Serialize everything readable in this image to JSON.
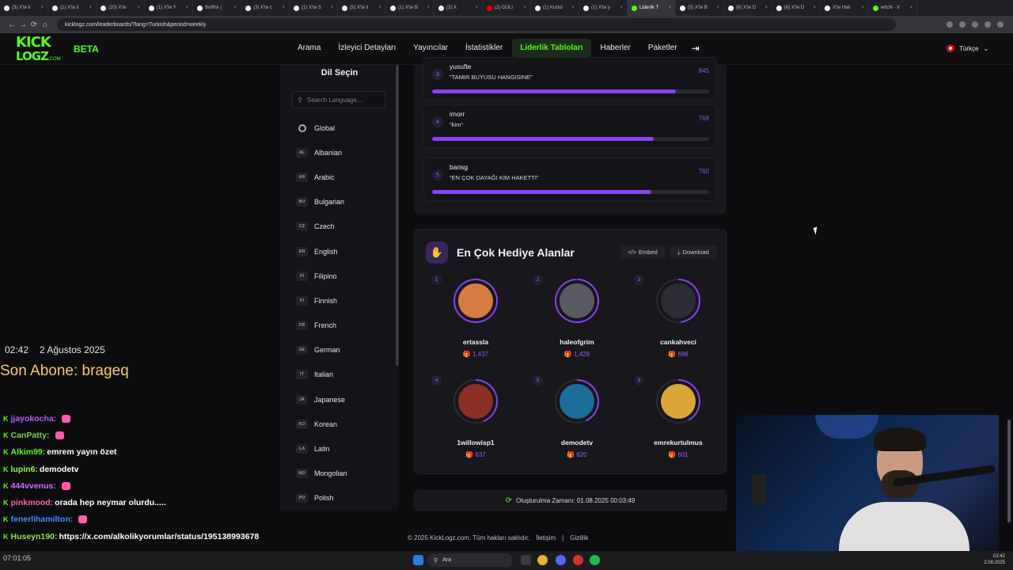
{
  "browser": {
    "tabs": [
      {
        "label": "(3) X'te li",
        "icon": "x-icon"
      },
      {
        "label": "(1) X'te li",
        "icon": "x-icon"
      },
      {
        "label": "(20) X'te",
        "icon": "x-icon"
      },
      {
        "label": "(1) X'te Y",
        "icon": "x-icon"
      },
      {
        "label": "BotRix |",
        "icon": "botrix-icon"
      },
      {
        "label": "(3) X'te c",
        "icon": "x-icon"
      },
      {
        "label": "(1) X'te S",
        "icon": "x-icon"
      },
      {
        "label": "(5) X'te li",
        "icon": "x-icon"
      },
      {
        "label": "(1) X'te B",
        "icon": "x-icon"
      },
      {
        "label": "(2) X",
        "icon": "x-icon"
      },
      {
        "label": "(2) GÜLI",
        "icon": "youtube-icon"
      },
      {
        "label": "(1) Kurtul",
        "icon": "x-icon"
      },
      {
        "label": "(1) X'te y",
        "icon": "x-icon"
      },
      {
        "label": "Liderlik T",
        "icon": "kick-icon",
        "active": true
      },
      {
        "label": "(5) X'te B",
        "icon": "x-icon"
      },
      {
        "label": "(6) X'te D",
        "icon": "x-icon"
      },
      {
        "label": "(6) X'te D",
        "icon": "x-icon"
      },
      {
        "label": "X'te Hak",
        "icon": "x-icon"
      },
      {
        "label": "witcN - V",
        "icon": "kick-icon"
      }
    ],
    "url": "kicklogz.com/leaderboards/?lang=Turkish&period=weekly"
  },
  "header": {
    "logo_line1": "KICK",
    "logo_line2": "LOGZ",
    "logo_suffix": ".COM",
    "beta": "BETA",
    "nav": [
      "Arama",
      "İzleyici Detayları",
      "Yayıncılar",
      "İstatistikler",
      "Liderlik Tabloları",
      "Haberler",
      "Paketler"
    ],
    "nav_active_index": 4,
    "language": "Türkçe"
  },
  "sidebar": {
    "title": "Dil Seçin",
    "search_placeholder": "Search Language...",
    "languages": [
      {
        "code": "",
        "name": "Global"
      },
      {
        "code": "AL",
        "name": "Albanian"
      },
      {
        "code": "AR",
        "name": "Arabic"
      },
      {
        "code": "BU",
        "name": "Bulgarian"
      },
      {
        "code": "CZ",
        "name": "Czech"
      },
      {
        "code": "EN",
        "name": "English"
      },
      {
        "code": "FI",
        "name": "Filipino"
      },
      {
        "code": "FI",
        "name": "Finnish"
      },
      {
        "code": "FR",
        "name": "French"
      },
      {
        "code": "GE",
        "name": "German"
      },
      {
        "code": "IT",
        "name": "Italian"
      },
      {
        "code": "JA",
        "name": "Japanese"
      },
      {
        "code": "KO",
        "name": "Korean"
      },
      {
        "code": "LA",
        "name": "Latin"
      },
      {
        "code": "MO",
        "name": "Mongolian"
      },
      {
        "code": "PO",
        "name": "Polish"
      }
    ]
  },
  "previous_card": {
    "rows": [
      {
        "rank": "3",
        "name": "yusufte",
        "message": "\"TAMIR BUYUSU HANGISINE\"",
        "score": "845",
        "fill": 0.88
      },
      {
        "rank": "4",
        "name": "imorr",
        "message": "\"kim\"",
        "score": "768",
        "fill": 0.8
      },
      {
        "rank": "5",
        "name": "barisg",
        "message": "\"EN ÇOK DAYAĞI KİM HAKETTİ\"",
        "score": "760",
        "fill": 0.79
      }
    ]
  },
  "gifters": {
    "title": "En Çok Hediye Alanlar",
    "embed_label": "Embed",
    "download_label": "Download",
    "items": [
      {
        "rank": "1",
        "name": "ertassla",
        "count": "1,437",
        "fill": 1.0,
        "avatar_color": "#d77a43"
      },
      {
        "rank": "2",
        "name": "haleofgrim",
        "count": "1,428",
        "fill": 0.99,
        "avatar_color": "#5a5a62"
      },
      {
        "rank": "3",
        "name": "cankahveci",
        "count": "696",
        "fill": 0.48,
        "avatar_color": "#2c2c34"
      },
      {
        "rank": "4",
        "name": "1willowisp1",
        "count": "637",
        "fill": 0.44,
        "avatar_color": "#8c2f25"
      },
      {
        "rank": "5",
        "name": "demodetv",
        "count": "620",
        "fill": 0.43,
        "avatar_color": "#1a6e98"
      },
      {
        "rank": "6",
        "name": "emrekurtulmus",
        "count": "601",
        "fill": 0.42,
        "avatar_color": "#d8a63a"
      }
    ]
  },
  "created_at": "Oluşturulma Zamanı: 01.08.2025 00:03:49",
  "footer": {
    "copyright": "© 2025 KickLogz.com. Tüm hakları saklıdır.",
    "contact": "İletişim",
    "privacy": "Gizlilik"
  },
  "overlay": {
    "time": "02:42",
    "date": "2 Ağustos 2025",
    "last_sub": "Son Abone: brageq",
    "chat": [
      {
        "user": "jjayokocha:",
        "msg": "",
        "color": "#b15cff"
      },
      {
        "user": "CanPatty:",
        "msg": "",
        "color": "#7bd13f"
      },
      {
        "user": "Alkim99:",
        "msg": "emrem yayın özet",
        "color": "#53fc18"
      },
      {
        "user": "lupin6:",
        "msg": "demodetv",
        "color": "#9bf54e"
      },
      {
        "user": "444vvenus:",
        "msg": "",
        "color": "#d36cff"
      },
      {
        "user": "pinkmood:",
        "msg": "orada hep neymar olurdu.....",
        "color": "#ff5fa8"
      },
      {
        "user": "fenerlihamilton:",
        "msg": "",
        "color": "#3b8cff"
      },
      {
        "user": "Huseyn190:",
        "msg": "https://x.com/alkolikyorumlar/status/195138993678",
        "color": "#8ee04b"
      }
    ]
  },
  "taskbar": {
    "search": "Ara",
    "clock_time": "02:42",
    "clock_date": "2.08.2025",
    "left_text": "07:01:05"
  }
}
